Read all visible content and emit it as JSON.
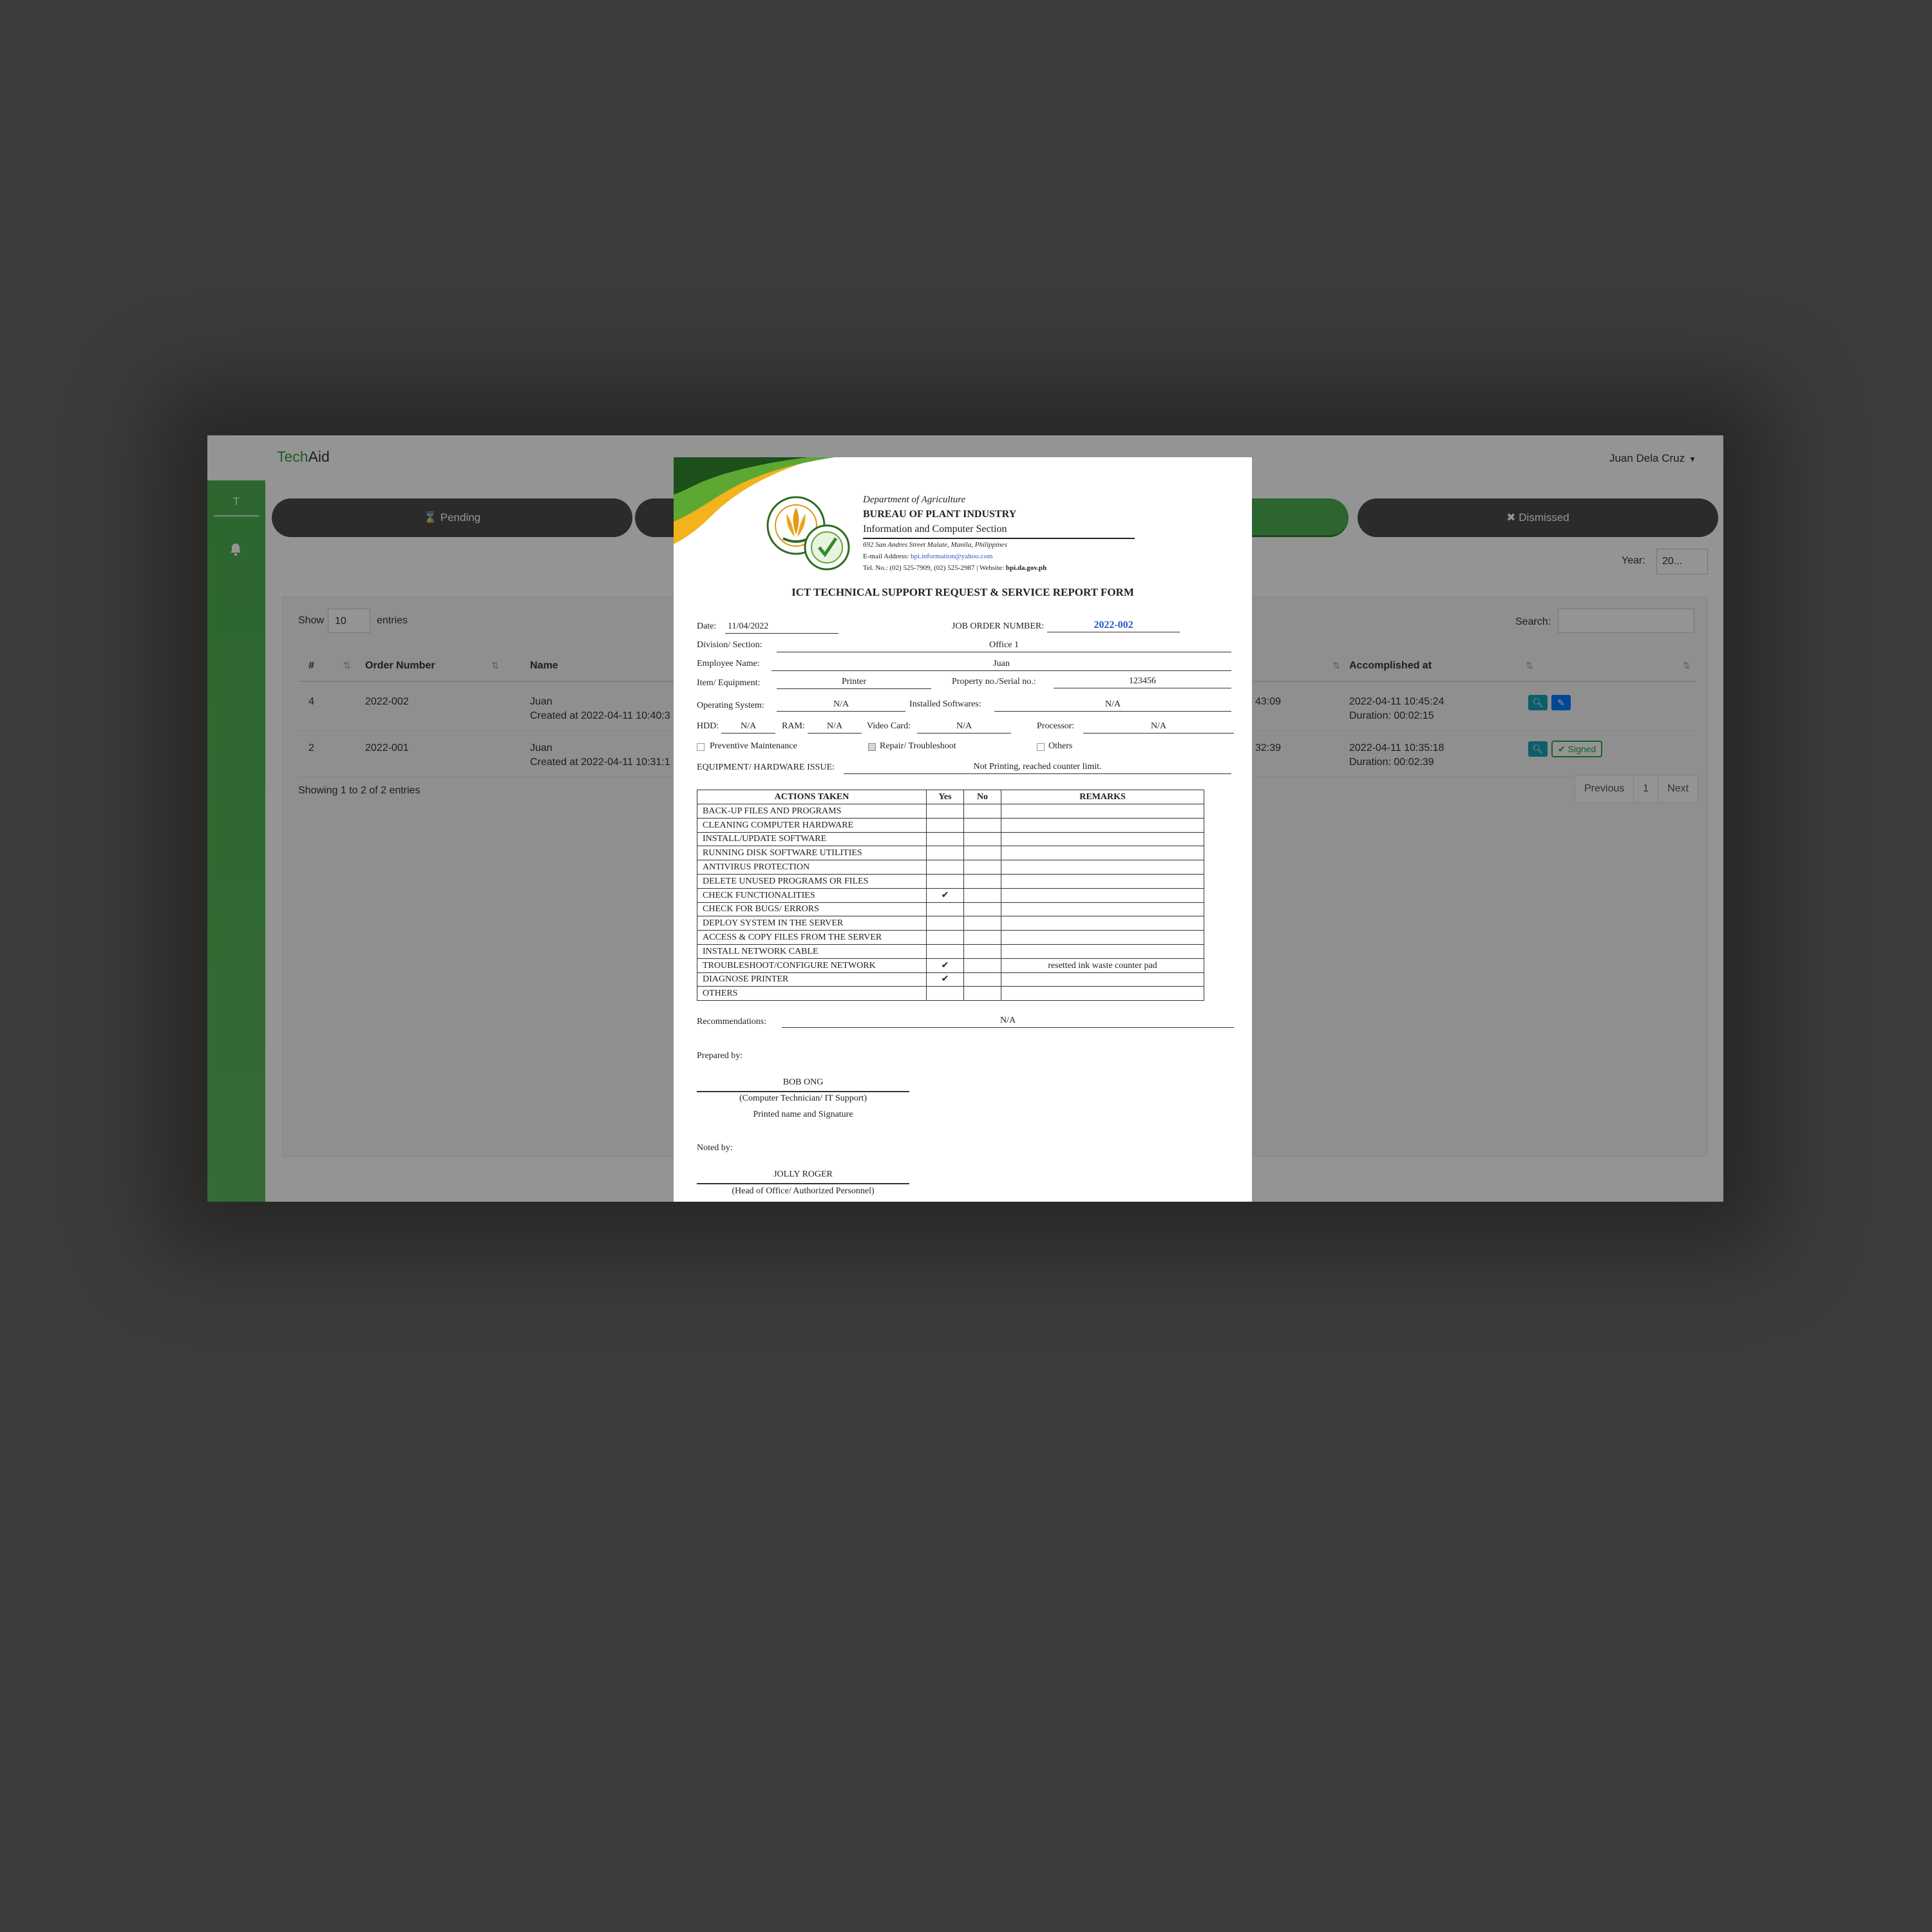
{
  "app": {
    "brand_prefix": "Tech",
    "brand_suffix": "Aid",
    "user_name": "Juan Dela Cruz",
    "sidebar_avatar": "T"
  },
  "tabs": [
    {
      "label": "Pending",
      "icon": "hourglass-icon"
    },
    {
      "label": "",
      "icon": ""
    },
    {
      "label": "",
      "icon": ""
    },
    {
      "label": "Dismissed",
      "icon": "close-icon"
    }
  ],
  "filters": {
    "year_label": "Year:",
    "year_value": "20...",
    "show_label": "Show",
    "length_value": "10",
    "entries_label": "entries",
    "search_label": "Search:"
  },
  "table": {
    "headers": [
      "#",
      "Order Number",
      "Name",
      "Accomplished at"
    ],
    "rows": [
      {
        "num": "4",
        "order": "2022-002",
        "name": "Juan",
        "created": "Created at 2022-04-11 10:40:3",
        "partial_time": "43:09",
        "accomplished": "2022-04-11 10:45:24",
        "duration": "Duration: 00:02:15"
      },
      {
        "num": "2",
        "order": "2022-001",
        "name": "Juan",
        "created": "Created at 2022-04-11 10:31:1",
        "partial_time": "32:39",
        "accomplished": "2022-04-11 10:35:18",
        "duration": "Duration: 00:02:39",
        "badge": "Signed"
      }
    ],
    "info": "Showing 1 to 2 of 2 entries",
    "pagination": [
      "Previous",
      "1",
      "Next"
    ]
  },
  "document": {
    "dept": "Department of Agriculture",
    "bureau": "BUREAU OF PLANT INDUSTRY",
    "section": "Information and Computer Section",
    "address": "692 San Andres Street Malate, Manila, Philippines",
    "email_label": "E-mail Address:",
    "email": "bpi.information@yahoo.com",
    "tel": "Tel. No.: (02) 525-7909, (02) 525-2987 | Website:",
    "website": "bpi.da.gov.ph",
    "title": "ICT TECHNICAL SUPPORT REQUEST & SERVICE REPORT FORM",
    "fields": {
      "date_label": "Date:",
      "date": "11/04/2022",
      "job_label": "JOB ORDER NUMBER:",
      "job": "2022-002",
      "division_label": "Division/ Section:",
      "division": "Office 1",
      "employee_label": "Employee Name:",
      "employee": "Juan",
      "item_label": "Item/ Equipment:",
      "item": "Printer",
      "property_label": "Property no./Serial no.:",
      "property": "123456",
      "os_label": "Operating System:",
      "os": "N/A",
      "software_label": "Installed Softwares:",
      "software": "N/A",
      "hdd_label": "HDD:",
      "hdd": "N/A",
      "ram_label": "RAM:",
      "ram": "N/A",
      "video_label": "Video Card:",
      "video": "N/A",
      "processor_label": "Processor:",
      "processor": "N/A",
      "opt_preventive": "Preventive Maintenance",
      "opt_repair": "Repair/ Troubleshoot",
      "opt_others": "Others",
      "issue_label": "EQUIPMENT/ HARDWARE ISSUE:",
      "issue": "Not Printing, reached counter limit."
    },
    "actions_headers": [
      "ACTIONS TAKEN",
      "Yes",
      "No",
      "REMARKS"
    ],
    "actions": [
      {
        "label": "BACK-UP FILES AND PROGRAMS",
        "yes": "",
        "remarks": ""
      },
      {
        "label": "CLEANING COMPUTER HARDWARE",
        "yes": "",
        "remarks": ""
      },
      {
        "label": "INSTALL/UPDATE SOFTWARE",
        "yes": "",
        "remarks": ""
      },
      {
        "label": "RUNNING DISK SOFTWARE UTILITIES",
        "yes": "",
        "remarks": ""
      },
      {
        "label": "ANTIVIRUS PROTECTION",
        "yes": "",
        "remarks": ""
      },
      {
        "label": "DELETE UNUSED PROGRAMS OR FILES",
        "yes": "",
        "remarks": ""
      },
      {
        "label": "CHECK FUNCTIONALITIES",
        "yes": "✔",
        "remarks": ""
      },
      {
        "label": "CHECK FOR BUGS/ ERRORS",
        "yes": "",
        "remarks": ""
      },
      {
        "label": "DEPLOY SYSTEM IN THE SERVER",
        "yes": "",
        "remarks": ""
      },
      {
        "label": "ACCESS & COPY FILES FROM THE SERVER",
        "yes": "",
        "remarks": ""
      },
      {
        "label": "INSTALL NETWORK CABLE",
        "yes": "",
        "remarks": ""
      },
      {
        "label": "TROUBLESHOOT/CONFIGURE NETWORK",
        "yes": "✔",
        "remarks": "resetted ink waste counter pad"
      },
      {
        "label": "DIAGNOSE PRINTER",
        "yes": "✔",
        "remarks": ""
      },
      {
        "label": "OTHERS",
        "yes": "",
        "remarks": ""
      }
    ],
    "recommendations_label": "Recommendations:",
    "recommendations": "N/A",
    "prepared_label": "Prepared by:",
    "prepared_name": "BOB ONG",
    "prepared_role": "(Computer Technician/ IT Support)",
    "prepared_note": "Printed name and Signature",
    "noted_label": "Noted by:",
    "noted_name": "JOLLY ROGER",
    "noted_role": "(Head of Office/ Authorized Personnel)"
  }
}
